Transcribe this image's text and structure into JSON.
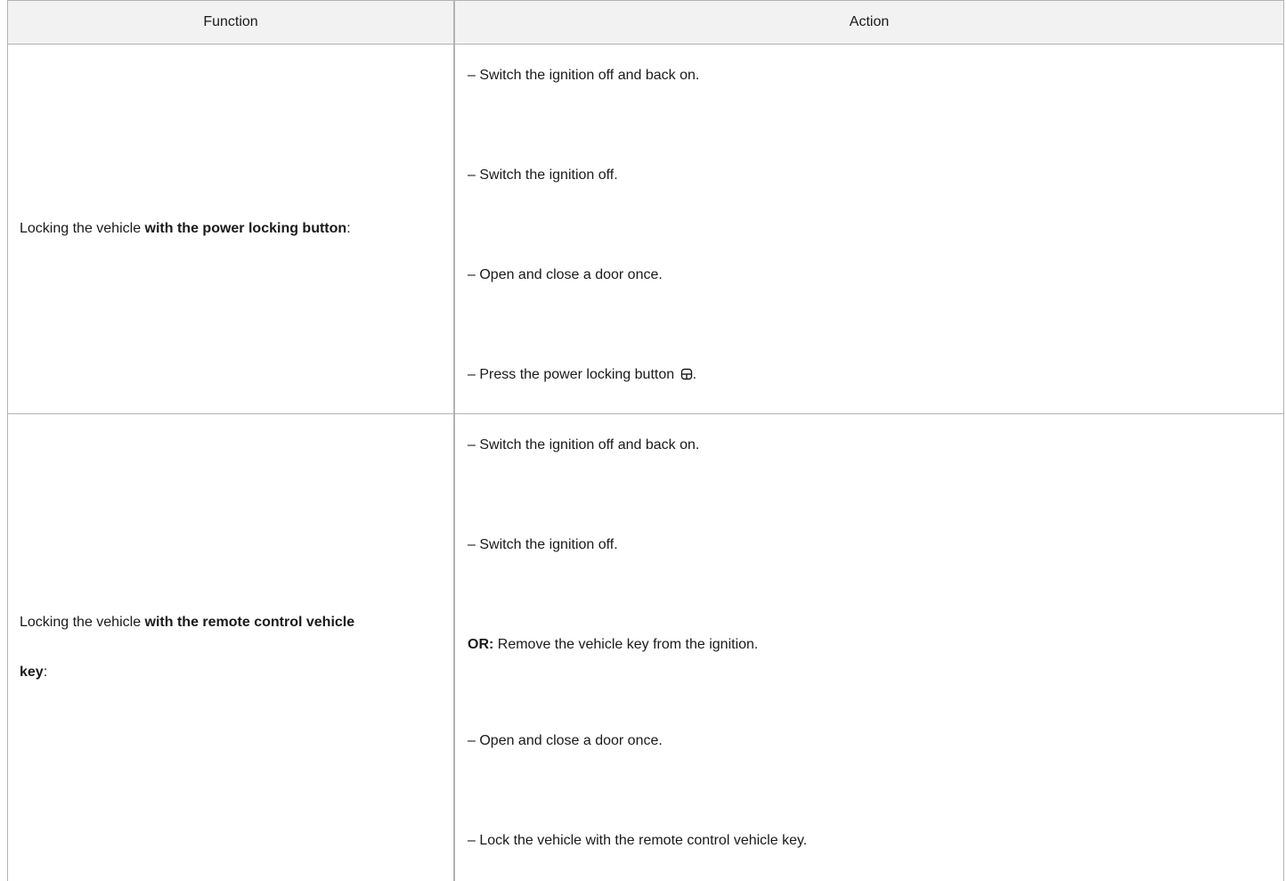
{
  "header": {
    "function": "Function",
    "action": "Action"
  },
  "rows": [
    {
      "function_prefix": "Locking the vehicle ",
      "function_bold": "with the power locking button",
      "function_suffix": ":",
      "actions": [
        "– Switch the ignition off and back on.",
        "– Switch the ignition off.",
        "– Open and close a door once.",
        "– Press the power locking button "
      ],
      "action_suffix": ".",
      "icon": "lock-icon"
    },
    {
      "function_prefix": "Locking the vehicle ",
      "function_bold_line1": "with the remote control vehicle",
      "function_bold_line2": "key",
      "function_suffix": ":",
      "actions": [
        "– Switch the ignition off and back on.",
        "– Switch the ignition off.",
        "",
        "– Open and close a door once.",
        "– Lock the vehicle with the remote control vehicle key."
      ],
      "or_label": "OR:",
      "or_text": " Remove the vehicle key from the ignition."
    }
  ]
}
